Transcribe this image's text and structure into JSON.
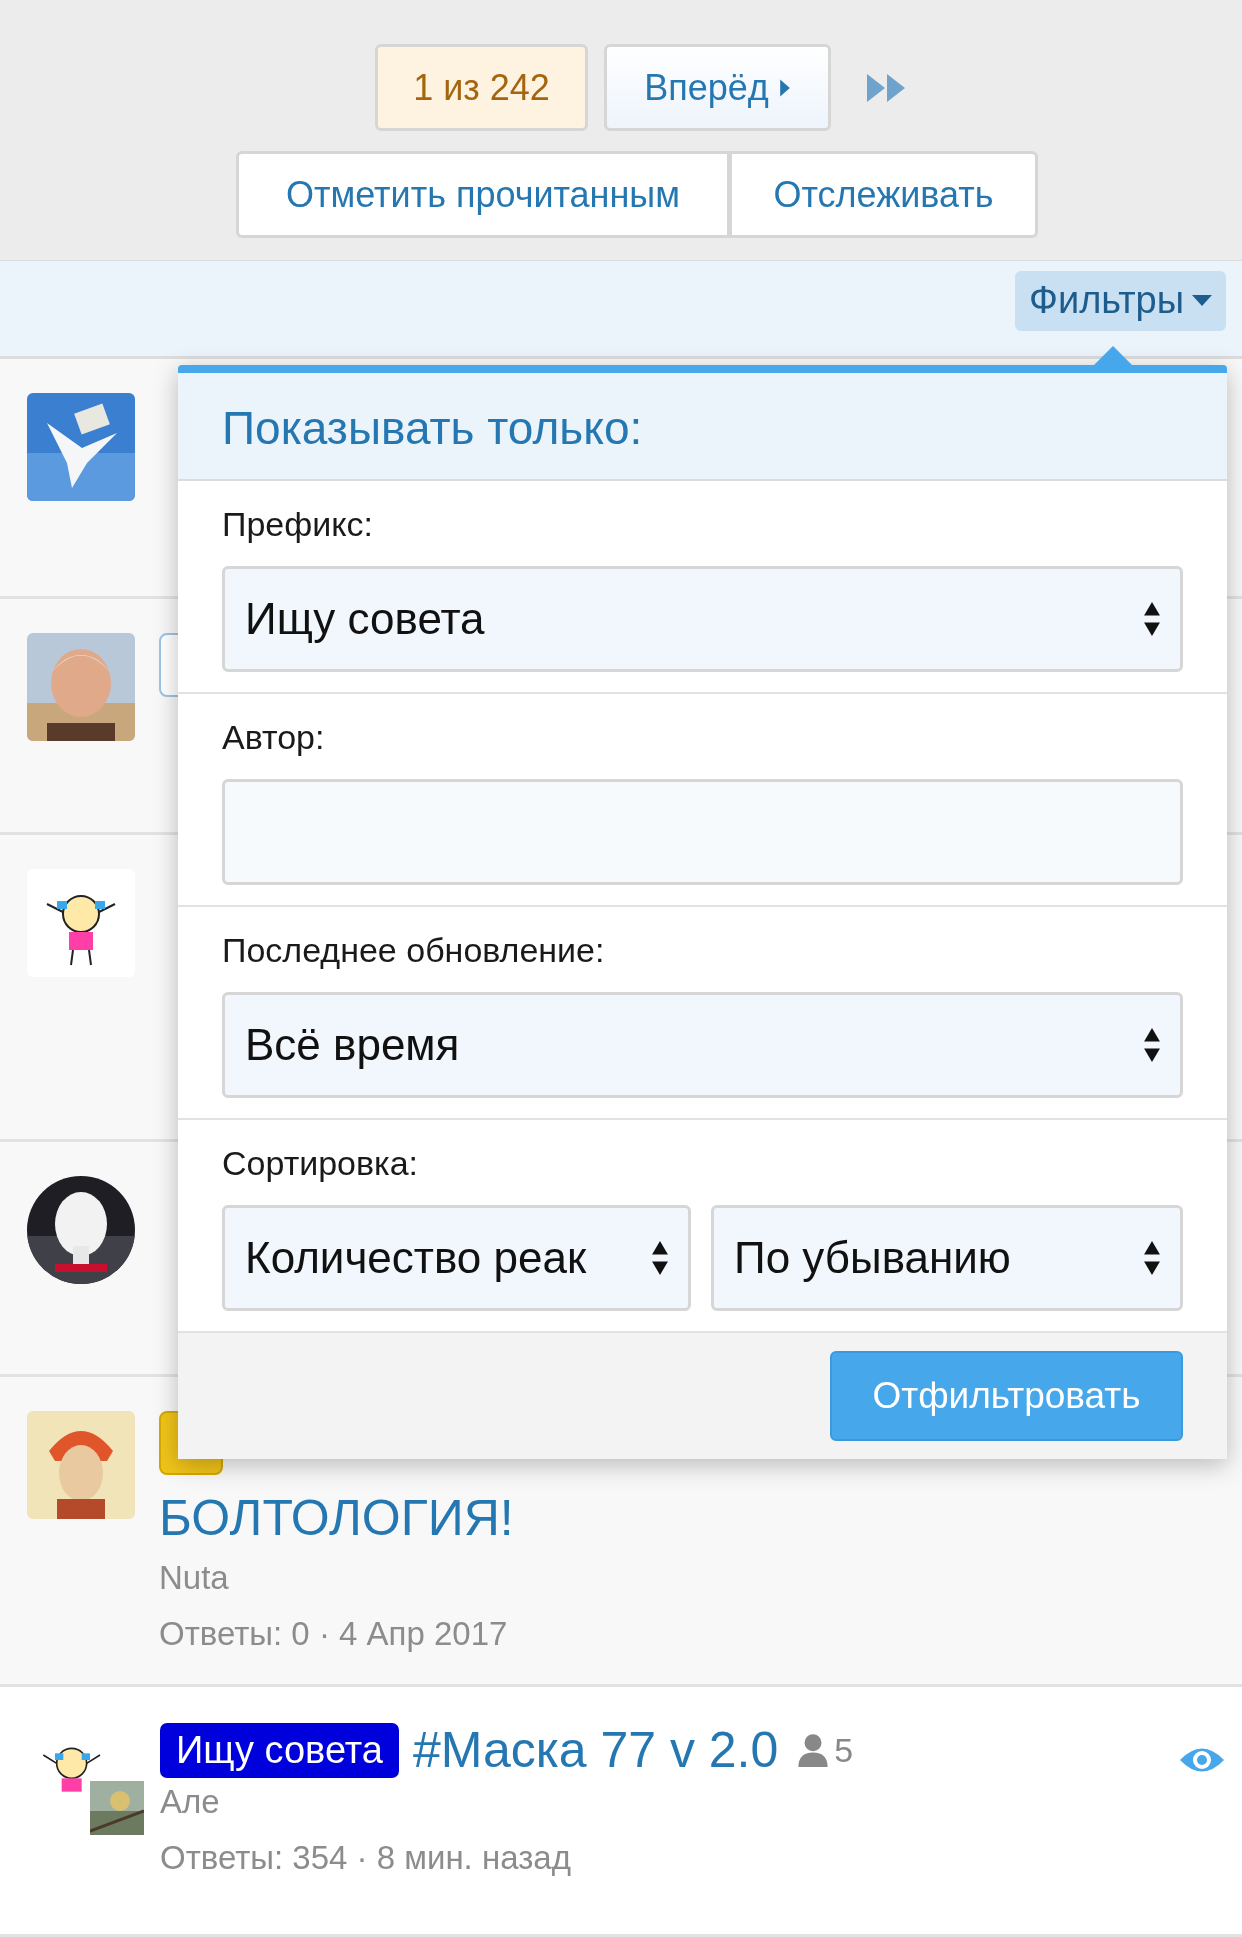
{
  "pagination": {
    "current": {
      "label": "1 из 242",
      "selected": true
    },
    "next": {
      "label": "Вперёд"
    }
  },
  "actions": [
    {
      "label": "Отметить прочитанным"
    },
    {
      "label": "Отслеживать"
    }
  ],
  "filters_button": {
    "label": "Фильтры",
    "expanded": true
  },
  "filter_menu": {
    "title": "Показывать только:",
    "fields": [
      {
        "kind": "select",
        "label": "Префикс:",
        "value": "Ищу совета"
      },
      {
        "kind": "input",
        "label": "Автор:"
      },
      {
        "kind": "select",
        "label": "Последнее обновление:",
        "value": "Всё время"
      },
      {
        "kind": "pair",
        "label": "Сортировка:",
        "values": [
          "Количество реак",
          "По убыванию"
        ]
      }
    ],
    "submit": "Отфильтровать"
  },
  "threads": [
    {
      "kind": "covered"
    },
    {
      "kind": "covered",
      "color": "#ffffff"
    },
    {
      "kind": "covered"
    },
    {
      "kind": "covered"
    },
    {
      "kind": "visible",
      "color": "#f0c419",
      "title": "БОЛТОЛОГИЯ!",
      "author": "Nuta",
      "meta": "Ответы: 0 · 4 Апр 2017"
    }
  ],
  "last_thread": {
    "prefix": "Ищу совета",
    "color": "#0000dd",
    "title": "#Маска 77 v 2.0",
    "participants": "5",
    "author": "Але",
    "meta": "Ответы: 354 · 8 мин. назад",
    "watched": true
  }
}
